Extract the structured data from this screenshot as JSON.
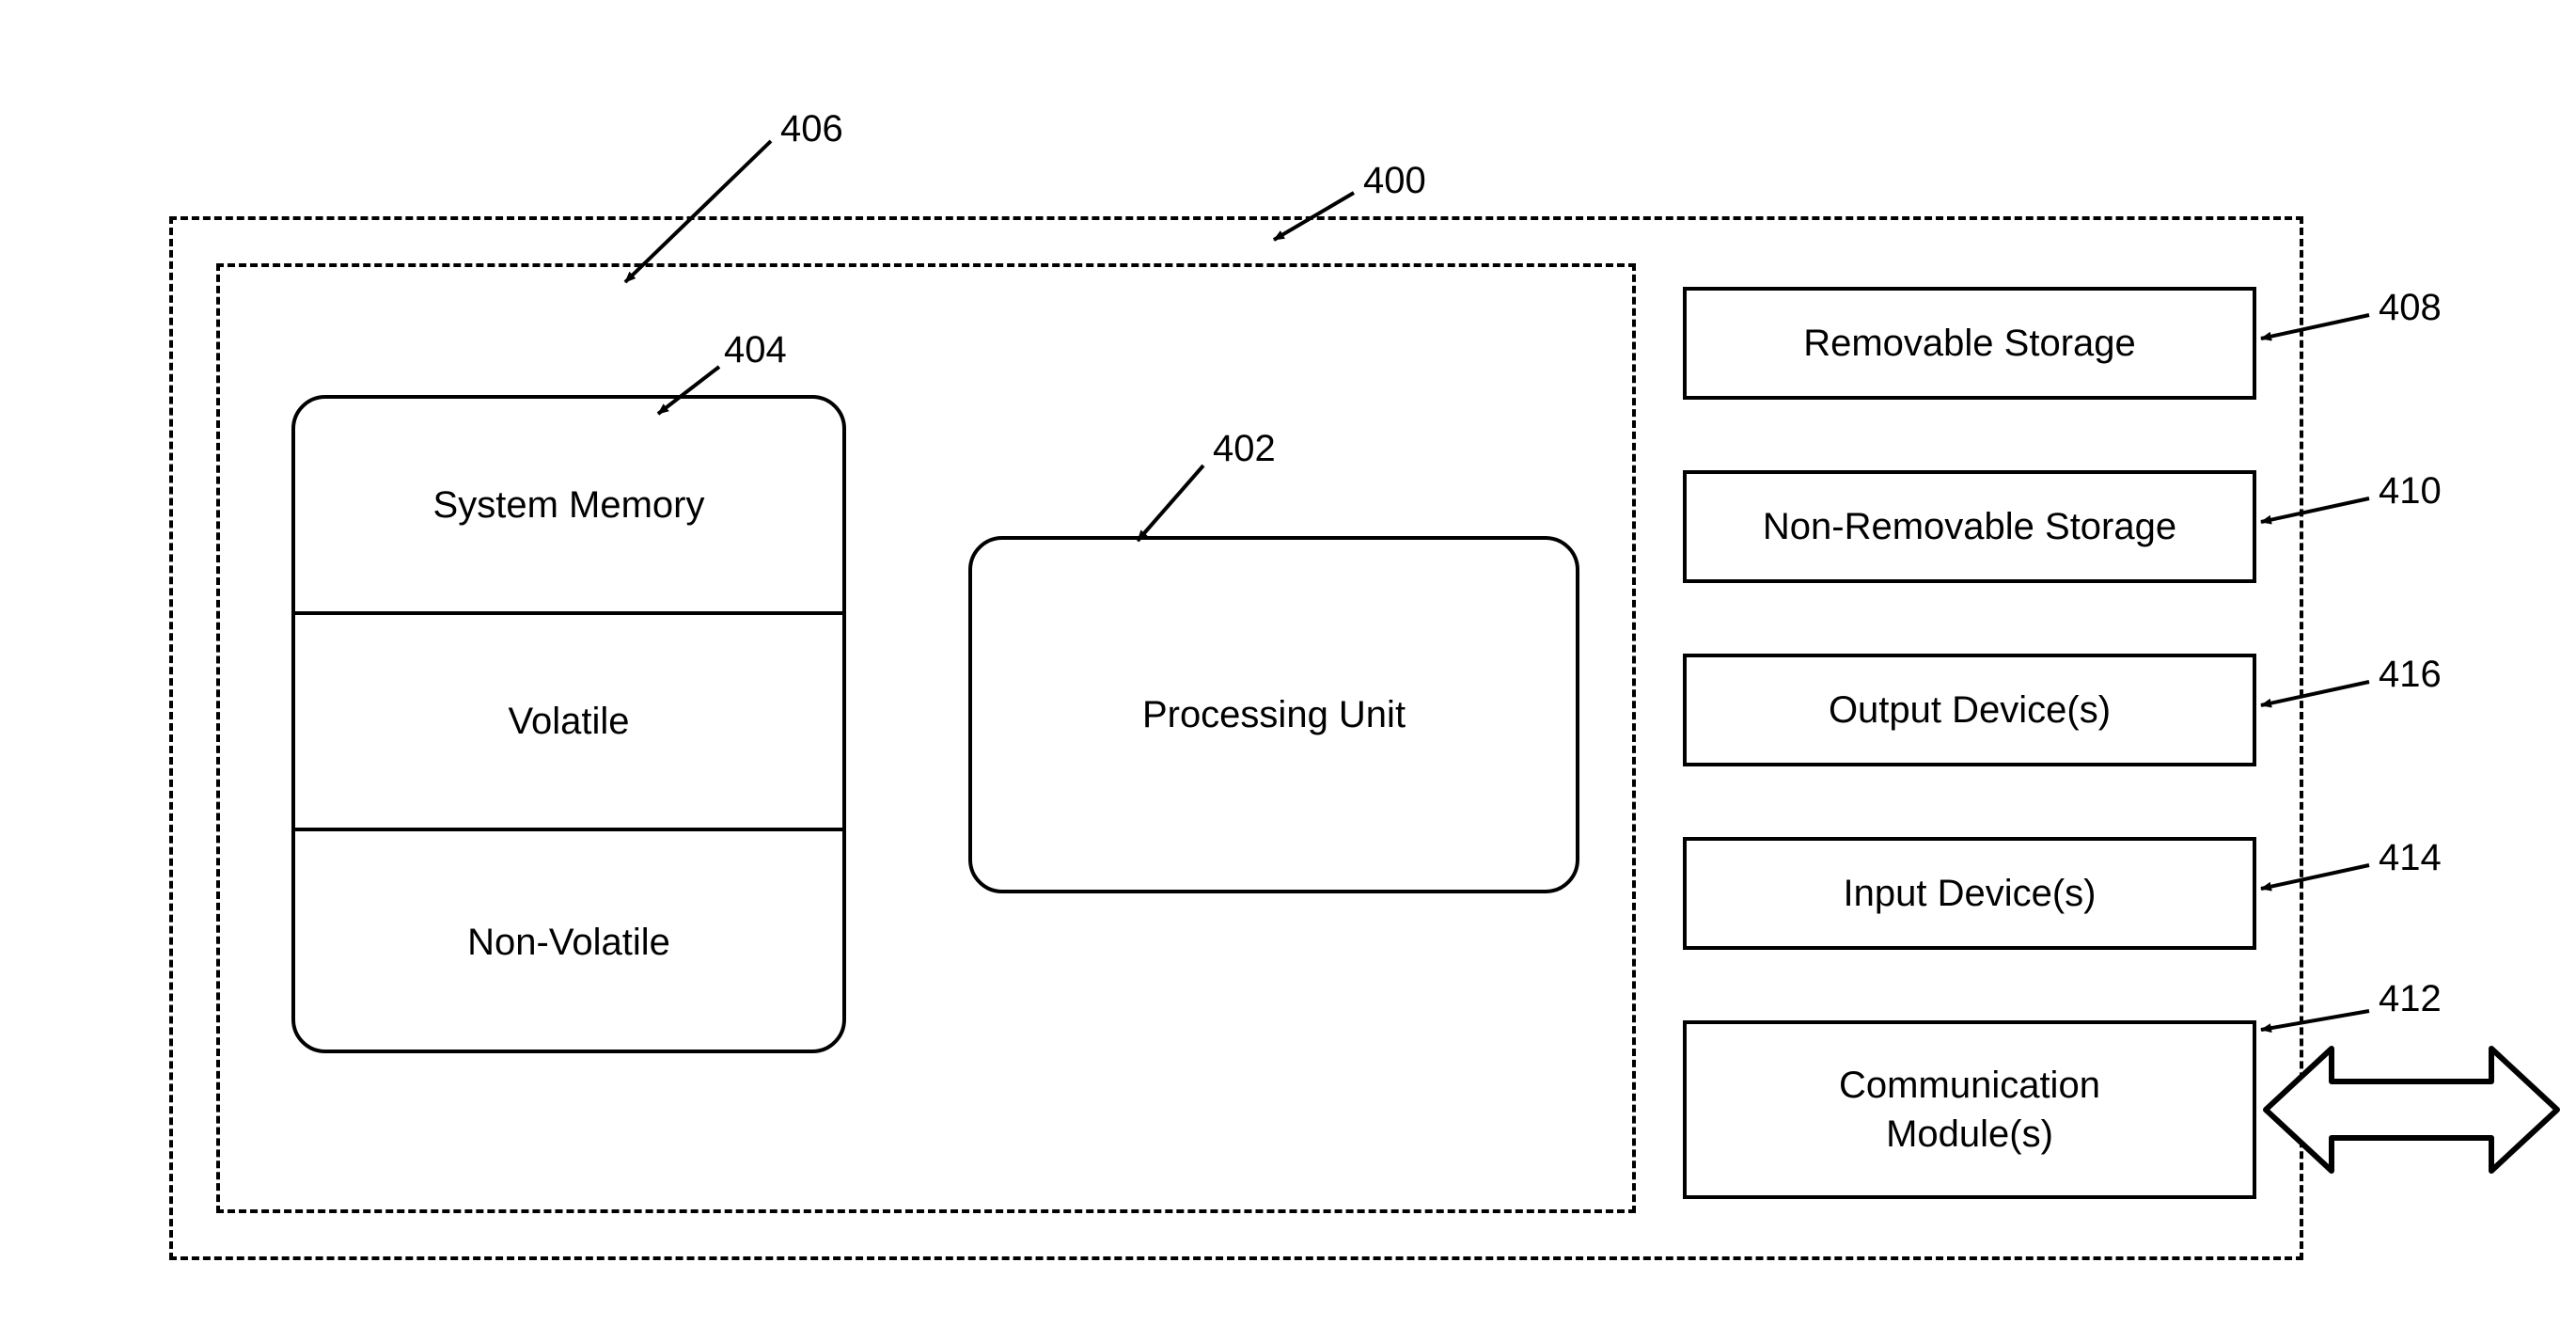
{
  "refs": {
    "outer": "400",
    "inner": "406",
    "memory": "404",
    "processing": "402",
    "removable": "408",
    "nonremovable": "410",
    "output": "416",
    "input": "414",
    "comm": "412"
  },
  "blocks": {
    "system_memory": "System Memory",
    "volatile": "Volatile",
    "nonvolatile": "Non-Volatile",
    "processing_unit": "Processing Unit",
    "removable_storage": "Removable Storage",
    "nonremovable_storage": "Non-Removable Storage",
    "output_devices": "Output Device(s)",
    "input_devices": "Input Device(s)",
    "communication_modules": "Communication\nModule(s)"
  }
}
